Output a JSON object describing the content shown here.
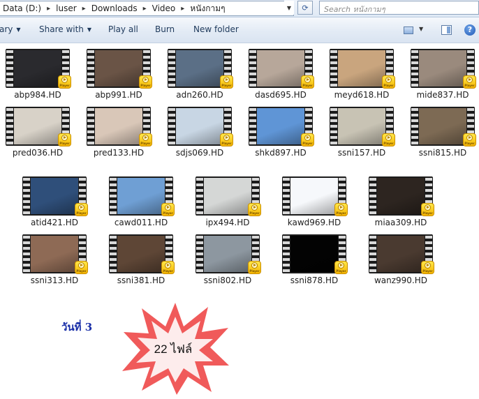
{
  "address": {
    "crumbs": [
      "Data (D:)",
      "luser",
      "Downloads",
      "Video",
      "หนังกามๆ"
    ],
    "separator": "▸"
  },
  "search": {
    "placeholder": "Search หนังกามๆ"
  },
  "toolbar": {
    "organize_label": "ary",
    "share_label": "Share with",
    "play_label": "Play all",
    "burn_label": "Burn",
    "new_folder_label": "New folder"
  },
  "badge_text": "Player",
  "files": [
    {
      "name": "abp984.HD",
      "scene": "#2a2a2e"
    },
    {
      "name": "abp991.HD",
      "scene": "#6a5446"
    },
    {
      "name": "adn260.HD",
      "scene": "#5b6f86"
    },
    {
      "name": "dasd695.HD",
      "scene": "#b7a79a"
    },
    {
      "name": "meyd618.HD",
      "scene": "#c9a57e"
    },
    {
      "name": "mide837.HD",
      "scene": "#9a8a7d"
    },
    {
      "name": "pred036.HD",
      "scene": "#d8d2c8"
    },
    {
      "name": "pred133.HD",
      "scene": "#d9c7b8"
    },
    {
      "name": "sdjs069.HD",
      "scene": "#c8d6e4"
    },
    {
      "name": "shkd897.HD",
      "scene": "#5f95d6"
    },
    {
      "name": "ssni157.HD",
      "scene": "#c8c3b4"
    },
    {
      "name": "ssni815.HD",
      "scene": "#7d6a54"
    },
    {
      "name": "atid421.HD",
      "scene": "#2f4f7a"
    },
    {
      "name": "cawd011.HD",
      "scene": "#6f9fd4"
    },
    {
      "name": "ipx494.HD",
      "scene": "#d5d7d6"
    },
    {
      "name": "kawd969.HD",
      "scene": "#f6f8fb"
    },
    {
      "name": "miaa309.HD",
      "scene": "#2d2520"
    },
    {
      "name": "ssni313.HD",
      "scene": "#8e6a55"
    },
    {
      "name": "ssni381.HD",
      "scene": "#5e4636"
    },
    {
      "name": "ssni802.HD",
      "scene": "#8d97a0"
    },
    {
      "name": "ssni878.HD",
      "scene": "#030303"
    },
    {
      "name": "wanz990.HD",
      "scene": "#4a3a30"
    }
  ],
  "annotation": {
    "day_label": "วันที่ 3",
    "count_label": "22 ไฟล์",
    "burst_color": "#f05a5a"
  }
}
